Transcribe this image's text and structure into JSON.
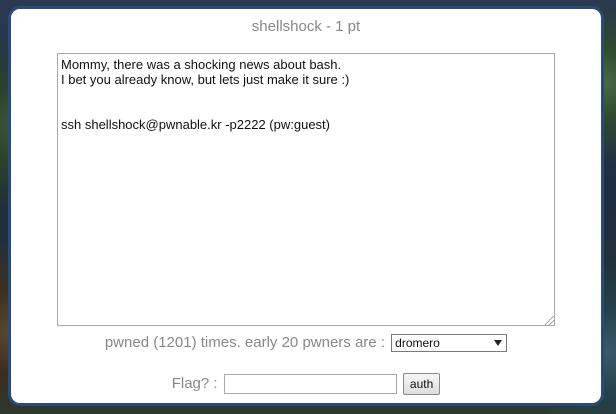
{
  "challenge": {
    "title": "shellshock - 1 pt",
    "description": "Mommy, there was a shocking news about bash.\nI bet you already know, but lets just make it sure :)\n\n\nssh shellshock@pwnable.kr -p2222 (pw:guest)"
  },
  "pwners": {
    "label": "pwned (1201) times. early 20 pwners are :",
    "selected": "dromero"
  },
  "flag": {
    "label": "Flag? :",
    "value": "",
    "submit_label": "auth"
  }
}
